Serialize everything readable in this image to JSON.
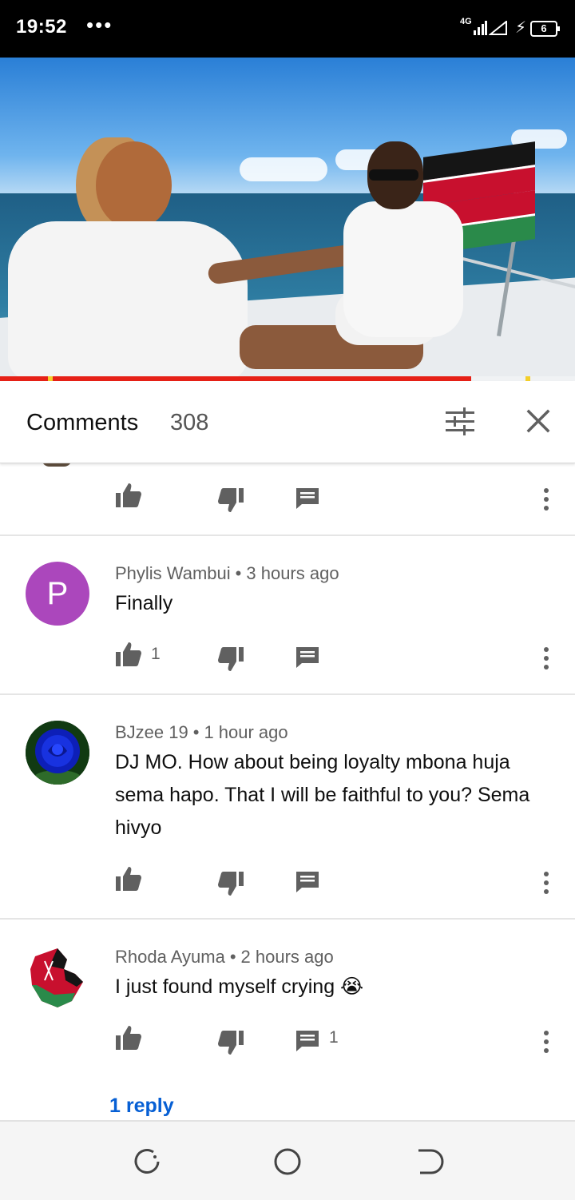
{
  "status_bar": {
    "time": "19:52",
    "notification_dots": "•••",
    "network_type": "4G",
    "battery_level": "6"
  },
  "video": {
    "progress_fraction": 0.82,
    "progress_color": "#e62117"
  },
  "comments_header": {
    "title": "Comments",
    "count": "308"
  },
  "comments": [
    {
      "author": "Phylis Wambui",
      "time_ago": "3 hours ago",
      "avatar_letter": "P",
      "avatar_color": "#ab47bc",
      "text": "Finally",
      "like_count": "1",
      "reply_count": ""
    },
    {
      "author": "BJzee 19",
      "time_ago": "1 hour ago",
      "avatar_icon": "blue-rose-avatar",
      "text": "DJ MO. How about being loyalty mbona huja sema hapo.  That I will be faithful to you? Sema hivyo",
      "like_count": "",
      "reply_count": ""
    },
    {
      "author": "Rhoda Ayuma",
      "time_ago": "2 hours ago",
      "avatar_icon": "kenya-map-avatar",
      "text": "I just found myself crying 😭",
      "like_count": "",
      "reply_count": "1",
      "replies_link": "1 reply"
    }
  ],
  "colors": {
    "link": "#065fd4",
    "secondary_text": "#606060"
  }
}
